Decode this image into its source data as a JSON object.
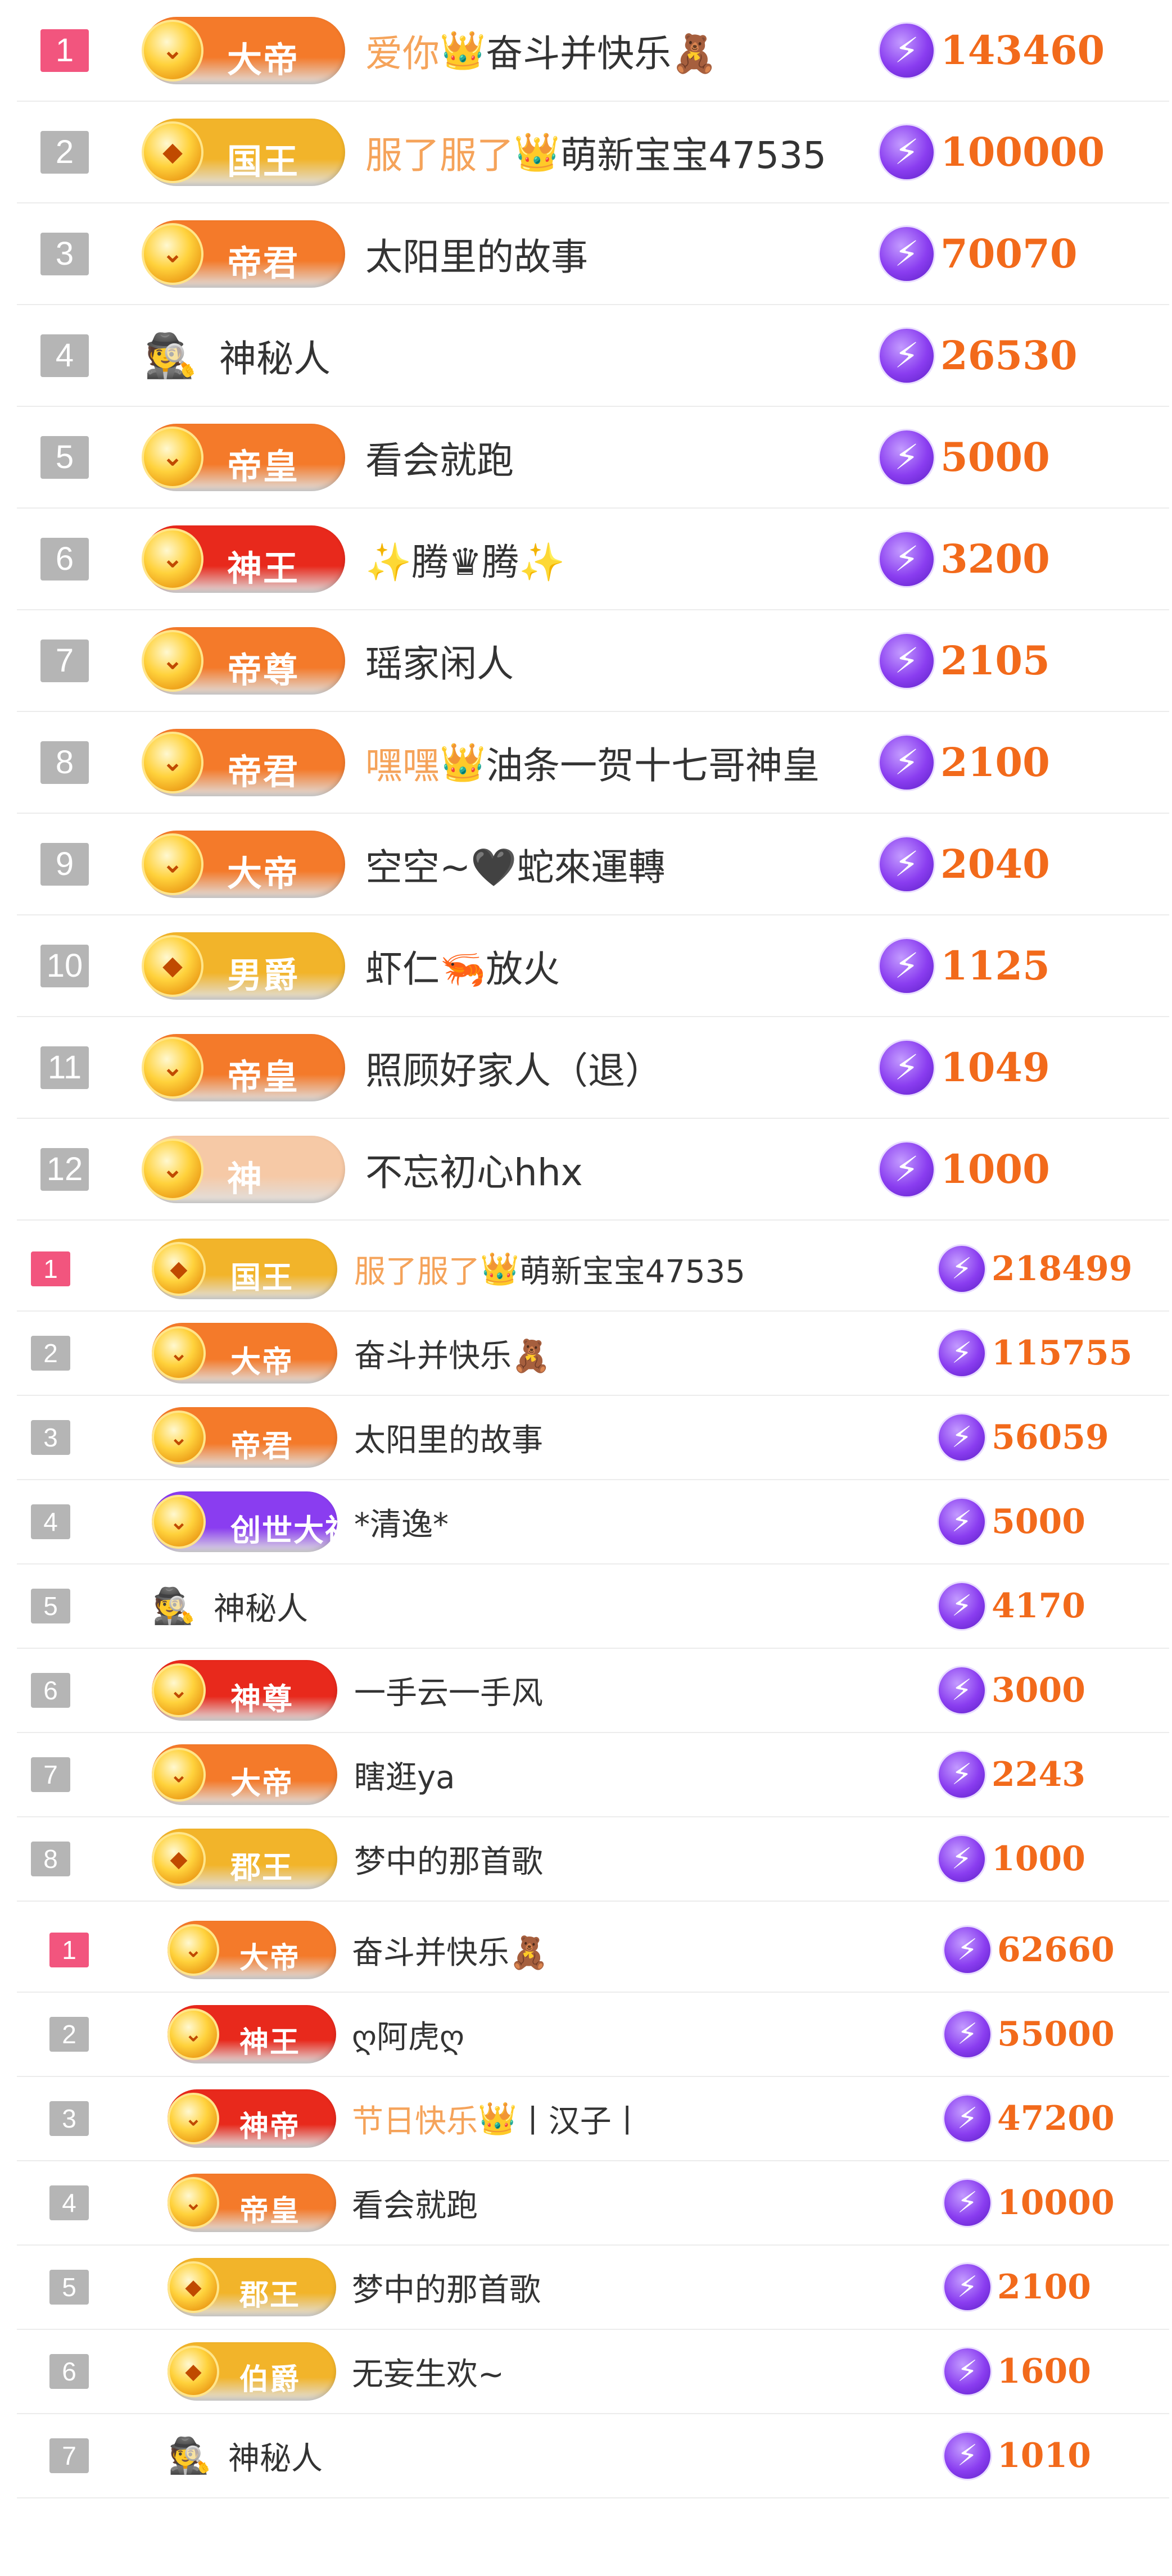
{
  "bolt_glyph": "⚡",
  "mystery_glyph": "🕵",
  "crown_glyph": "👑",
  "section_a": {
    "rows": [
      {
        "rank": "1",
        "badge": {
          "label": "大帝",
          "icon": "chevron-icon",
          "color": "#f47a2a"
        },
        "prefix": "爱你",
        "crown": true,
        "name": "奋斗并快乐🧸",
        "amount": "143460"
      },
      {
        "rank": "2",
        "badge": {
          "label": "国王",
          "icon": "gem-icon",
          "color": "#f2b42a"
        },
        "prefix": "服了服了",
        "crown": true,
        "name": "萌新宝宝47535",
        "amount": "100000"
      },
      {
        "rank": "3",
        "badge": {
          "label": "帝君",
          "icon": "chevron-icon",
          "color": "#f47a2a"
        },
        "prefix": "",
        "crown": false,
        "name": "太阳里的故事",
        "amount": "70070"
      },
      {
        "rank": "4",
        "badge": null,
        "prefix": "",
        "crown": false,
        "name": "神秘人",
        "amount": "26530"
      },
      {
        "rank": "5",
        "badge": {
          "label": "帝皇",
          "icon": "chevron-icon",
          "color": "#f47a2a"
        },
        "prefix": "",
        "crown": false,
        "name": "看会就跑",
        "amount": "5000"
      },
      {
        "rank": "6",
        "badge": {
          "label": "神王",
          "icon": "chevron-icon",
          "color": "#e8291c"
        },
        "prefix": "",
        "crown": false,
        "name": "✨腾♛腾✨",
        "amount": "3200"
      },
      {
        "rank": "7",
        "badge": {
          "label": "帝尊",
          "icon": "chevron-icon",
          "color": "#f47a2a"
        },
        "prefix": "",
        "crown": false,
        "name": "瑶家闲人",
        "amount": "2105"
      },
      {
        "rank": "8",
        "badge": {
          "label": "帝君",
          "icon": "chevron-icon",
          "color": "#f47a2a"
        },
        "prefix": "嘿嘿",
        "crown": true,
        "name": "油条一贺十七哥神皇",
        "amount": "2100"
      },
      {
        "rank": "9",
        "badge": {
          "label": "大帝",
          "icon": "chevron-icon",
          "color": "#f47a2a"
        },
        "prefix": "",
        "crown": false,
        "name": "空空~🖤蛇來運轉",
        "amount": "2040"
      },
      {
        "rank": "10",
        "badge": {
          "label": "男爵",
          "icon": "gem-icon",
          "color": "#f2b42a"
        },
        "prefix": "",
        "crown": false,
        "name": "虾仁🦐放火",
        "amount": "1125"
      },
      {
        "rank": "11",
        "badge": {
          "label": "帝皇",
          "icon": "chevron-icon",
          "color": "#f47a2a"
        },
        "prefix": "",
        "crown": false,
        "name": "照顾好家人（退）",
        "amount": "1049"
      },
      {
        "rank": "12",
        "badge": {
          "label": "神",
          "icon": "chevron-icon",
          "color": "#f6c9a6"
        },
        "prefix": "",
        "crown": false,
        "name": "不忘初心hhx",
        "amount": "1000"
      }
    ]
  },
  "section_b": {
    "rows": [
      {
        "rank": "1",
        "badge": {
          "label": "国王",
          "icon": "gem-icon",
          "color": "#f2b42a"
        },
        "prefix": "服了服了",
        "crown": true,
        "name": "萌新宝宝47535",
        "amount": "218499"
      },
      {
        "rank": "2",
        "badge": {
          "label": "大帝",
          "icon": "chevron-icon",
          "color": "#f47a2a"
        },
        "prefix": "",
        "crown": false,
        "name": "奋斗并快乐🧸",
        "amount": "115755"
      },
      {
        "rank": "3",
        "badge": {
          "label": "帝君",
          "icon": "chevron-icon",
          "color": "#f47a2a"
        },
        "prefix": "",
        "crown": false,
        "name": "太阳里的故事",
        "amount": "56059"
      },
      {
        "rank": "4",
        "badge": {
          "label": "创世大神",
          "icon": "chevron-icon",
          "color": "#8a3df0"
        },
        "prefix": "",
        "crown": false,
        "name": "*清逸*",
        "amount": "5000"
      },
      {
        "rank": "5",
        "badge": null,
        "prefix": "",
        "crown": false,
        "name": "神秘人",
        "amount": "4170"
      },
      {
        "rank": "6",
        "badge": {
          "label": "神尊",
          "icon": "chevron-icon",
          "color": "#e8291c"
        },
        "prefix": "",
        "crown": false,
        "name": "一手云一手风",
        "amount": "3000"
      },
      {
        "rank": "7",
        "badge": {
          "label": "大帝",
          "icon": "chevron-icon",
          "color": "#f47a2a"
        },
        "prefix": "",
        "crown": false,
        "name": "瞎逛ya",
        "amount": "2243"
      },
      {
        "rank": "8",
        "badge": {
          "label": "郡王",
          "icon": "gem-icon",
          "color": "#f2b42a"
        },
        "prefix": "",
        "crown": false,
        "name": "梦中的那首歌",
        "amount": "1000"
      }
    ]
  },
  "section_c": {
    "rows": [
      {
        "rank": "1",
        "badge": {
          "label": "大帝",
          "icon": "chevron-icon",
          "color": "#f47a2a"
        },
        "prefix": "",
        "crown": false,
        "name": "奋斗并快乐🧸",
        "amount": "62660"
      },
      {
        "rank": "2",
        "badge": {
          "label": "神王",
          "icon": "chevron-icon",
          "color": "#e8291c"
        },
        "prefix": "",
        "crown": false,
        "name": "ღ阿虎ღ",
        "amount": "55000"
      },
      {
        "rank": "3",
        "badge": {
          "label": "神帝",
          "icon": "chevron-icon",
          "color": "#e8291c"
        },
        "prefix": "节日快乐",
        "crown": true,
        "name": "丨汉子丨",
        "amount": "47200"
      },
      {
        "rank": "4",
        "badge": {
          "label": "帝皇",
          "icon": "chevron-icon",
          "color": "#f47a2a"
        },
        "prefix": "",
        "crown": false,
        "name": "看会就跑",
        "amount": "10000"
      },
      {
        "rank": "5",
        "badge": {
          "label": "郡王",
          "icon": "gem-icon",
          "color": "#f2b42a"
        },
        "prefix": "",
        "crown": false,
        "name": "梦中的那首歌",
        "amount": "2100"
      },
      {
        "rank": "6",
        "badge": {
          "label": "伯爵",
          "icon": "gem-icon",
          "color": "#f2b42a"
        },
        "prefix": "",
        "crown": false,
        "name": "无妄生欢~",
        "amount": "1600"
      },
      {
        "rank": "7",
        "badge": null,
        "prefix": "",
        "crown": false,
        "name": "神秘人",
        "amount": "1010"
      }
    ]
  }
}
